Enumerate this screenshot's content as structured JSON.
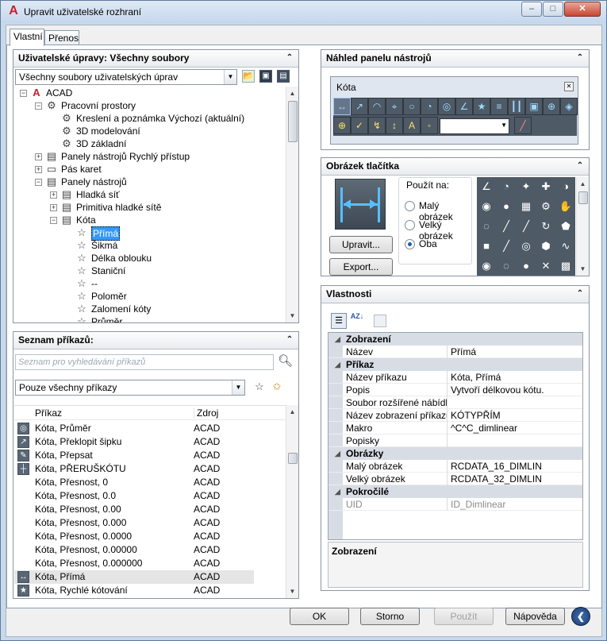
{
  "window": {
    "title": "Upravit uživatelské rozhraní",
    "minimize": "–",
    "maximize": "□",
    "close": "✕",
    "logo": "A"
  },
  "tabs": [
    {
      "label": "Vlastní",
      "active": true
    },
    {
      "label": "Přenos",
      "active": false
    }
  ],
  "customizations": {
    "header": "Uživatelské úpravy: Všechny soubory",
    "combo": "Všechny soubory uživatelských úprav",
    "tree": [
      {
        "label": "ACAD",
        "icon": "A",
        "expander": "−"
      },
      {
        "label": "Pracovní prostory",
        "icon": "⚙",
        "expander": "−"
      },
      {
        "label": "Kreslení a poznámka Výchozí (aktuální)",
        "icon": "⚙",
        "expander": ""
      },
      {
        "label": "3D modelování",
        "icon": "⚙",
        "expander": ""
      },
      {
        "label": "3D základní",
        "icon": "⚙",
        "expander": ""
      },
      {
        "label": "Panely nástrojů Rychlý přístup",
        "icon": "▤",
        "expander": "+"
      },
      {
        "label": "Pás karet",
        "icon": "▭",
        "expander": "+"
      },
      {
        "label": "Panely nástrojů",
        "icon": "▤",
        "expander": "−"
      },
      {
        "label": "Hladká síť",
        "icon": "▤",
        "expander": "+"
      },
      {
        "label": "Primitiva hladké sítě",
        "icon": "▤",
        "expander": "+"
      },
      {
        "label": "Kóta",
        "icon": "▤",
        "expander": "−"
      },
      {
        "label": "Přímá",
        "icon": "☆",
        "expander": "",
        "selected": true
      },
      {
        "label": "Šikmá",
        "icon": "☆",
        "expander": ""
      },
      {
        "label": "Délka oblouku",
        "icon": "☆",
        "expander": ""
      },
      {
        "label": "Staniční",
        "icon": "☆",
        "expander": ""
      },
      {
        "label": "--",
        "icon": "☆",
        "expander": ""
      },
      {
        "label": "Poloměr",
        "icon": "☆",
        "expander": ""
      },
      {
        "label": "Zalomení kóty",
        "icon": "☆",
        "expander": ""
      },
      {
        "label": "Průměr",
        "icon": "☆",
        "expander": ""
      }
    ]
  },
  "commands": {
    "header": "Seznam příkazů:",
    "search_placeholder": "Seznam pro vyhledávání příkazů",
    "filter": "Pouze všechny příkazy",
    "col_command": "Příkaz",
    "col_source": "Zdroj",
    "rows": [
      {
        "name": "Kóta, Průměr",
        "source": "ACAD",
        "icon": "◎"
      },
      {
        "name": "Kóta, Překlopit šipku",
        "source": "ACAD",
        "icon": "↗"
      },
      {
        "name": "Kóta, Přepsat",
        "source": "ACAD",
        "icon": "✎"
      },
      {
        "name": "Kóta, PŘERUŠKÓTU",
        "source": "ACAD",
        "icon": "┼"
      },
      {
        "name": "Kóta, Přesnost, 0",
        "source": "ACAD",
        "icon": ""
      },
      {
        "name": "Kóta, Přesnost, 0.0",
        "source": "ACAD",
        "icon": ""
      },
      {
        "name": "Kóta, Přesnost, 0.00",
        "source": "ACAD",
        "icon": ""
      },
      {
        "name": "Kóta, Přesnost, 0.000",
        "source": "ACAD",
        "icon": ""
      },
      {
        "name": "Kóta, Přesnost, 0.0000",
        "source": "ACAD",
        "icon": ""
      },
      {
        "name": "Kóta, Přesnost, 0.00000",
        "source": "ACAD",
        "icon": ""
      },
      {
        "name": "Kóta, Přesnost, 0.000000",
        "source": "ACAD",
        "icon": ""
      },
      {
        "name": "Kóta, Přímá",
        "source": "ACAD",
        "icon": "↔",
        "selected": true
      },
      {
        "name": "Kóta, Rychlé kótování",
        "source": "ACAD",
        "icon": "★"
      }
    ]
  },
  "preview": {
    "header": "Náhled panelu nástrojů",
    "toolbar_title": "Kóta",
    "toolbar_close": "✕",
    "row1": [
      "↔",
      "↗",
      "◠",
      "⌖",
      "○",
      "◔",
      "◎",
      "∠",
      "★",
      "≡",
      "┃┃",
      "▣",
      "⊕",
      "◈"
    ],
    "row2": [
      "⊕",
      "✓",
      "↯",
      "↕",
      "A",
      "◦"
    ]
  },
  "button_image": {
    "header": "Obrázek tlačítka",
    "use_for": "Použít na:",
    "small": "Malý obrázek",
    "large": "Velký obrázek",
    "both": "Oba",
    "edit": "Upravit...",
    "export": "Export...",
    "gallery": [
      "∠",
      "◔",
      "✦",
      "✚",
      "◑",
      "◉",
      "●",
      "▦",
      "⚙",
      "✋",
      "◌",
      "╱",
      "╱",
      "↻",
      "⬟",
      "■",
      "╱",
      "◎",
      "⬢",
      "∿",
      "◉",
      "◌",
      "●",
      "✕",
      "▩"
    ]
  },
  "properties": {
    "header": "Vlastnosti",
    "sort_az": "AZ",
    "categories": [
      {
        "name": "Zobrazení",
        "rows": [
          {
            "k": "Název",
            "v": "Přímá"
          }
        ]
      },
      {
        "name": "Příkaz",
        "rows": [
          {
            "k": "Název příkazu",
            "v": "Kóta, Přímá"
          },
          {
            "k": "Popis",
            "v": "Vytvoří délkovou kótu."
          },
          {
            "k": "Soubor rozšířené nábídky",
            "v": ""
          },
          {
            "k": "Název zobrazení příkazu",
            "v": "KÓTYPŘÍM"
          },
          {
            "k": "Makro",
            "v": "^C^C_dimlinear"
          },
          {
            "k": "Popisky",
            "v": ""
          }
        ]
      },
      {
        "name": "Obrázky",
        "rows": [
          {
            "k": "Malý obrázek",
            "v": "RCDATA_16_DIMLIN"
          },
          {
            "k": "Velký obrázek",
            "v": "RCDATA_32_DIMLIN"
          }
        ]
      },
      {
        "name": "Pokročilé",
        "rows": [
          {
            "k": "UID",
            "v": "ID_Dimlinear"
          }
        ]
      }
    ],
    "desc_title": "Zobrazení"
  },
  "footer": {
    "ok": "OK",
    "cancel": "Storno",
    "apply": "Použít",
    "help": "Nápověda",
    "back": "❮"
  }
}
